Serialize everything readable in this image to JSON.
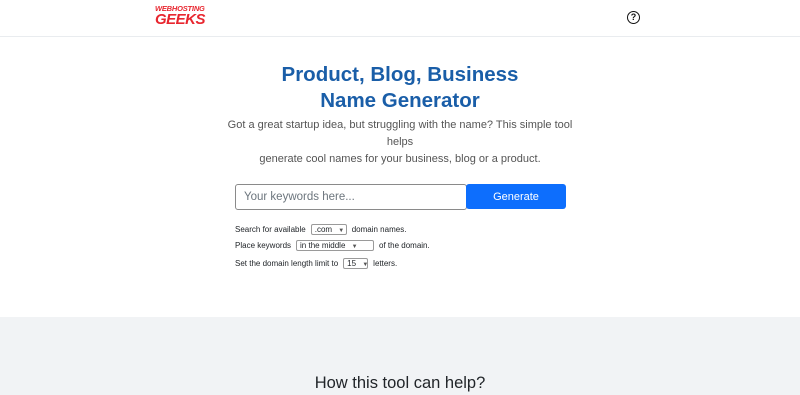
{
  "header": {
    "logo_line1": "WEBHOSTING",
    "logo_line2": "GEEKS",
    "help_icon": "question-circle-icon"
  },
  "hero": {
    "title_line1": "Product, Blog, Business",
    "title_line2": "Name Generator",
    "intro_line1": "Got a great startup idea, but struggling with the name? This simple tool helps",
    "intro_line2": "generate cool names for your business, blog or a product."
  },
  "search": {
    "placeholder": "Your keywords here...",
    "value": "",
    "button_label": "Generate"
  },
  "options": {
    "row1_prefix": "Search for available",
    "tld_value": ".com",
    "row1_suffix": "domain names.",
    "row2_prefix": "Place keywords",
    "position_value": "in the middle",
    "row2_suffix": "of the domain.",
    "row3_prefix": "Set the domain length limit to",
    "length_value": "15",
    "row3_suffix": "letters."
  },
  "section": {
    "title": "How this tool can help?"
  },
  "colors": {
    "brand_red": "#e8262f",
    "title_blue": "#1a5ea8",
    "button_blue": "#0d6efd",
    "band_gray": "#f1f3f5"
  }
}
